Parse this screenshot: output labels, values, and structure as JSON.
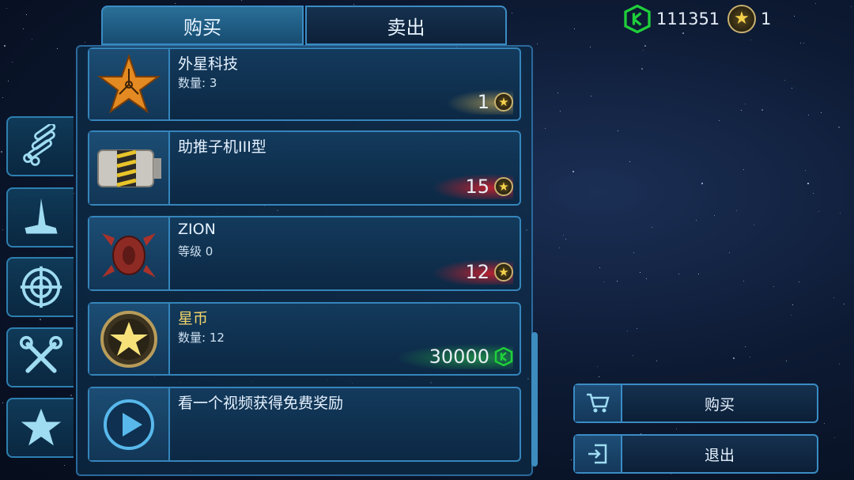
{
  "currency": {
    "green_amount": "111351",
    "gold_amount": "1"
  },
  "tabs": [
    {
      "label": "购买",
      "active": true
    },
    {
      "label": "卖出",
      "active": false
    }
  ],
  "sidebar": [
    {
      "icon": "pipes-icon"
    },
    {
      "icon": "wing-icon"
    },
    {
      "icon": "crosshair-icon"
    },
    {
      "icon": "tools-icon"
    },
    {
      "icon": "star-icon"
    }
  ],
  "items": [
    {
      "name": "外星科技",
      "sub": "数量: 3",
      "price": "1",
      "price_currency": "star-coin",
      "icon": "alien-tech-star-icon"
    },
    {
      "name": "助推子机III型",
      "sub": "",
      "price": "15",
      "price_currency": "star-coin",
      "icon": "booster-module-icon"
    },
    {
      "name": "ZION",
      "sub": "等级 0",
      "price": "12",
      "price_currency": "star-coin",
      "icon": "zion-ship-icon"
    },
    {
      "name": "星币",
      "sub": "数量: 12",
      "price": "30000",
      "price_currency": "green-credit",
      "icon": "star-coin-icon"
    },
    {
      "name": "看一个视频获得免费奖励",
      "sub": "",
      "price": "",
      "icon": "play-video-icon"
    }
  ],
  "actions": {
    "buy_label": "购买",
    "exit_label": "退出"
  },
  "colors": {
    "accent_blue": "#3585bb",
    "green_currency": "#1fcf3a",
    "gold": "#f5d24a",
    "price_glow_red": "#eb1e28"
  }
}
